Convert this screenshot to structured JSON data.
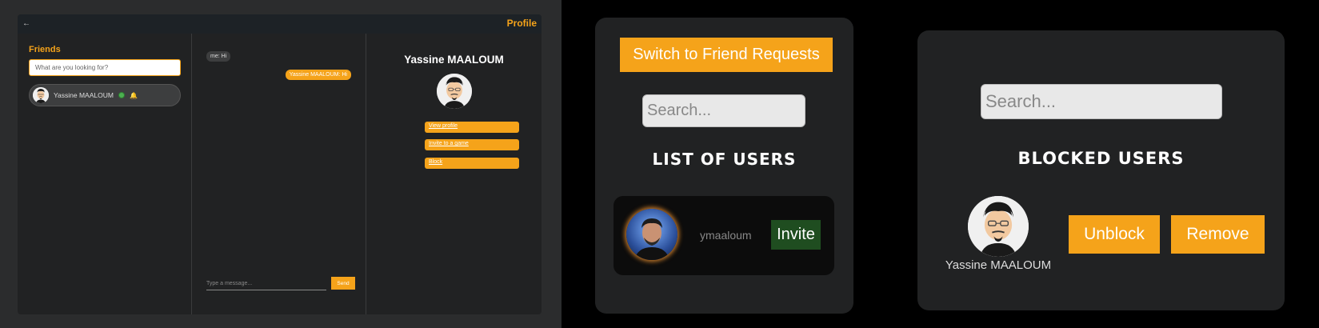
{
  "chat_app": {
    "header": {
      "back_icon": "←",
      "title": "Profile"
    },
    "friends": {
      "title": "Friends",
      "search_placeholder": "What are you looking for?",
      "items": [
        {
          "name": "Yassine MAALOUM",
          "status": "online",
          "bell_icon": "🔔"
        }
      ]
    },
    "messages": {
      "items": [
        {
          "direction": "in",
          "text": "me: Hi"
        },
        {
          "direction": "out",
          "text": "Yassine MAALOUM: Hi"
        }
      ],
      "input_placeholder": "Type a message...",
      "send_label": "Send"
    },
    "profile": {
      "name": "Yassine MAALOUM",
      "actions": [
        "View profile",
        "Invite to a game",
        "Block"
      ]
    }
  },
  "friend_requests": {
    "switch_label": "Switch to Friend Requests",
    "search_placeholder": "Search...",
    "list_title": "LIST OF USERS",
    "users": [
      {
        "login": "ymaaloum",
        "invite_label": "Invite"
      }
    ]
  },
  "blocked": {
    "search_placeholder": "Search...",
    "title": "BLOCKED USERS",
    "users": [
      {
        "name": "Yassine MAALOUM",
        "unblock_label": "Unblock",
        "remove_label": "Remove"
      }
    ]
  },
  "colors": {
    "accent": "#f5a31a",
    "online": "#4caf50",
    "invite": "#1f4d20",
    "panel": "#212223"
  }
}
